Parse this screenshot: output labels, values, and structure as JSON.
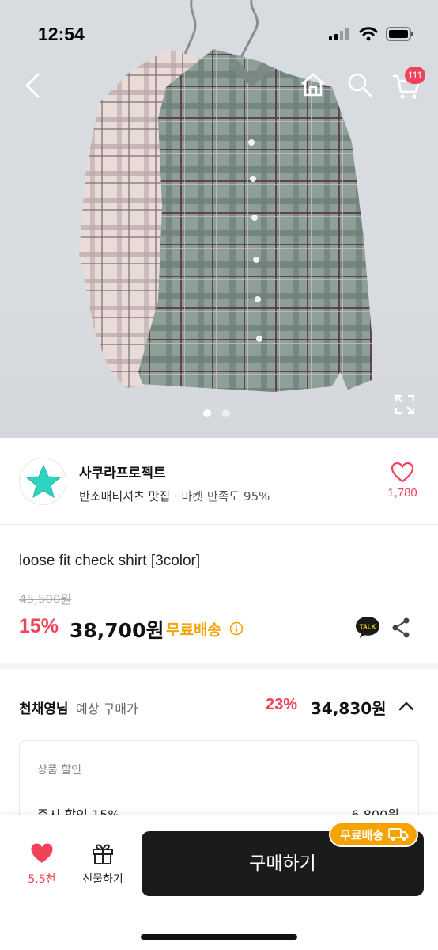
{
  "status": {
    "time": "12:54"
  },
  "nav": {
    "back_icon": "chevron-left-icon",
    "home_icon": "home-icon",
    "search_icon": "search-icon",
    "cart_icon": "cart-icon",
    "cart_badge": "111"
  },
  "gallery": {
    "page_count": 2,
    "current_page": 1
  },
  "seller": {
    "name": "사쿠라프로젝트",
    "tagline": "반소매티셔츠 맛집",
    "satisfaction": "· 마켓 만족도 95%",
    "likes": "1,780"
  },
  "product": {
    "title": "loose fit check shirt [3color]",
    "original_price": "45,500원",
    "discount_rate": "15%",
    "sale_price": "38,700원",
    "shipping": "무료배송"
  },
  "expected": {
    "user_name": "천채영님",
    "label": "예상 구매가",
    "rate": "23%",
    "price": "34,830원"
  },
  "discount_detail": {
    "heading": "상품 할인",
    "row_label": "즉시 할인 15%",
    "row_value": "-6,800원"
  },
  "bottom": {
    "like_count": "5.5천",
    "gift_label": "선물하기",
    "buy_label": "구매하기",
    "ship_badge": "무료배송"
  },
  "colors": {
    "accent_red": "#f0435a",
    "shipping_orange": "#f5a300",
    "button_dark": "#1b1b1b"
  }
}
